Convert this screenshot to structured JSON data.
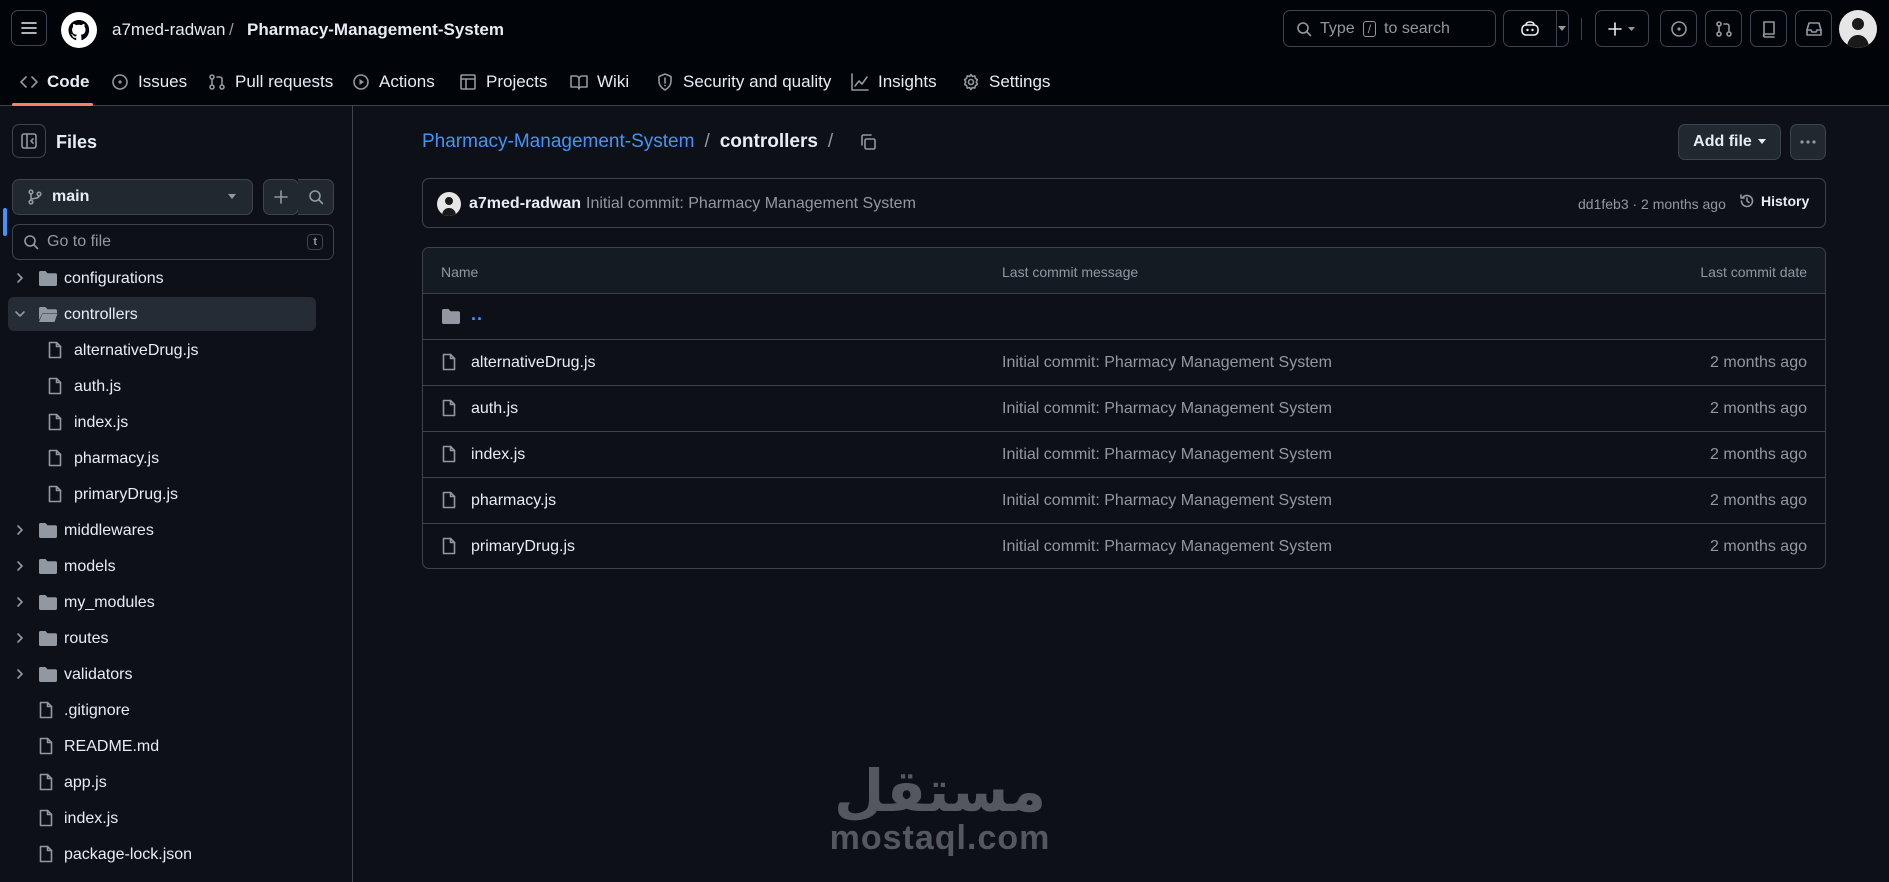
{
  "header": {
    "owner": "a7med-radwan",
    "separator": "/",
    "repo": "Pharmacy-Management-System",
    "search_prefix": "Type",
    "search_key": "/",
    "search_suffix": "to search"
  },
  "nav": {
    "items": [
      {
        "label": "Code",
        "icon": "code-icon"
      },
      {
        "label": "Issues",
        "icon": "issue-icon"
      },
      {
        "label": "Pull requests",
        "icon": "pull-request-icon"
      },
      {
        "label": "Actions",
        "icon": "play-icon"
      },
      {
        "label": "Projects",
        "icon": "table-icon"
      },
      {
        "label": "Wiki",
        "icon": "book-icon"
      },
      {
        "label": "Security and quality",
        "icon": "shield-icon"
      },
      {
        "label": "Insights",
        "icon": "graph-icon"
      },
      {
        "label": "Settings",
        "icon": "gear-icon"
      }
    ],
    "active": "Code"
  },
  "sidebar": {
    "title": "Files",
    "branch": "main",
    "goto_placeholder": "Go to file",
    "goto_key": "t",
    "tree": [
      {
        "label": "configurations",
        "type": "folder",
        "depth": 0
      },
      {
        "label": "controllers",
        "type": "folder-open",
        "depth": 0,
        "selected": true
      },
      {
        "label": "alternativeDrug.js",
        "type": "file",
        "depth": 1
      },
      {
        "label": "auth.js",
        "type": "file",
        "depth": 1
      },
      {
        "label": "index.js",
        "type": "file",
        "depth": 1
      },
      {
        "label": "pharmacy.js",
        "type": "file",
        "depth": 1
      },
      {
        "label": "primaryDrug.js",
        "type": "file",
        "depth": 1
      },
      {
        "label": "middlewares",
        "type": "folder",
        "depth": 0
      },
      {
        "label": "models",
        "type": "folder",
        "depth": 0
      },
      {
        "label": "my_modules",
        "type": "folder",
        "depth": 0
      },
      {
        "label": "routes",
        "type": "folder",
        "depth": 0
      },
      {
        "label": "validators",
        "type": "folder",
        "depth": 0
      },
      {
        "label": ".gitignore",
        "type": "file",
        "depth": 0
      },
      {
        "label": "README.md",
        "type": "file",
        "depth": 0
      },
      {
        "label": "app.js",
        "type": "file",
        "depth": 0
      },
      {
        "label": "index.js",
        "type": "file",
        "depth": 0
      },
      {
        "label": "package-lock.json",
        "type": "file",
        "depth": 0
      }
    ]
  },
  "main": {
    "breadcrumb_repo": "Pharmacy-Management-System",
    "breadcrumb_sep": "/",
    "breadcrumb_dir": "controllers",
    "add_file_label": "Add file",
    "commit": {
      "author": "a7med-radwan",
      "message": "Initial commit: Pharmacy Management System",
      "meta": "dd1feb3 · 2 months ago",
      "history_label": "History"
    },
    "table": {
      "headers": {
        "name": "Name",
        "message": "Last commit message",
        "date": "Last commit date"
      },
      "parent_link": "..",
      "rows": [
        {
          "name": "alternativeDrug.js",
          "message": "Initial commit: Pharmacy Management System",
          "date": "2 months ago"
        },
        {
          "name": "auth.js",
          "message": "Initial commit: Pharmacy Management System",
          "date": "2 months ago"
        },
        {
          "name": "index.js",
          "message": "Initial commit: Pharmacy Management System",
          "date": "2 months ago"
        },
        {
          "name": "pharmacy.js",
          "message": "Initial commit: Pharmacy Management System",
          "date": "2 months ago"
        },
        {
          "name": "primaryDrug.js",
          "message": "Initial commit: Pharmacy Management System",
          "date": "2 months ago"
        }
      ]
    }
  },
  "watermark": {
    "arabic": "مستقل",
    "latin": "mostaql.com"
  },
  "colors": {
    "bg": "#0d1117",
    "header_bg": "#010409",
    "link": "#4493f8",
    "accent_underline": "#f78166",
    "border": "#3d444d",
    "muted": "#9198a1"
  }
}
